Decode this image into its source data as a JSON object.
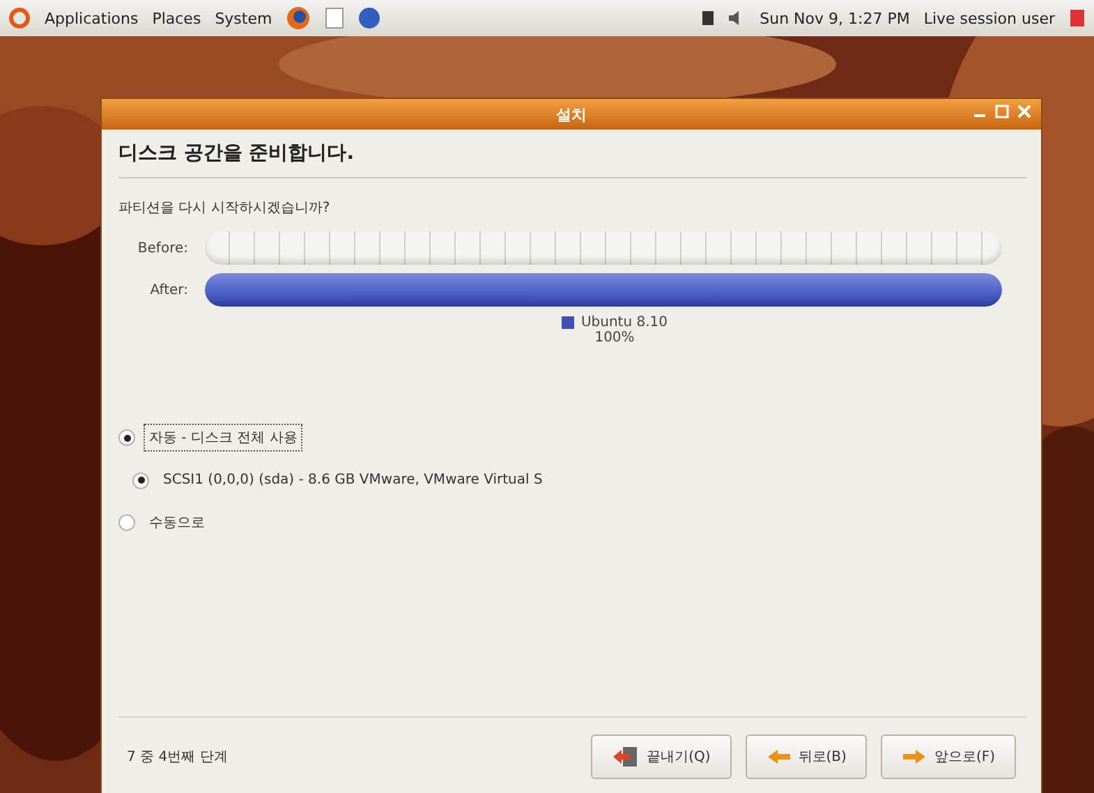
{
  "top_panel": {
    "menus": [
      "Applications",
      "Places",
      "System"
    ],
    "clock": "Sun Nov  9,  1:27 PM",
    "user": "Live session user"
  },
  "window": {
    "title": "설치"
  },
  "heading": "디스크 공간을 준비합니다.",
  "question": "파티션을 다시 시작하시겠습니까?",
  "partition_bars": [
    {
      "label": "Before:",
      "kind": "empty"
    },
    {
      "label": "After:",
      "kind": "filled",
      "level": 1
    }
  ],
  "legend": {
    "name": "Ubuntu 8.10",
    "percent": "100%",
    "color": "#3f51b5"
  },
  "options": [
    {
      "label": "자동 - 디스크 전체 사용",
      "selected": true,
      "children": [
        {
          "label": "SCSI1 (0,0,0) (sda) - 8.6 GB VMware, VMware Virtual S",
          "selected": true
        }
      ]
    },
    {
      "label": "수동으로",
      "selected": false
    }
  ],
  "footer": {
    "step": "7 중 4번째 단계",
    "buttons": [
      {
        "label": "끝내기(Q)",
        "kind": "quit"
      },
      {
        "label": "뒤로(B)",
        "kind": "back"
      },
      {
        "label": "앞으로(F)",
        "kind": "forward"
      }
    ]
  }
}
